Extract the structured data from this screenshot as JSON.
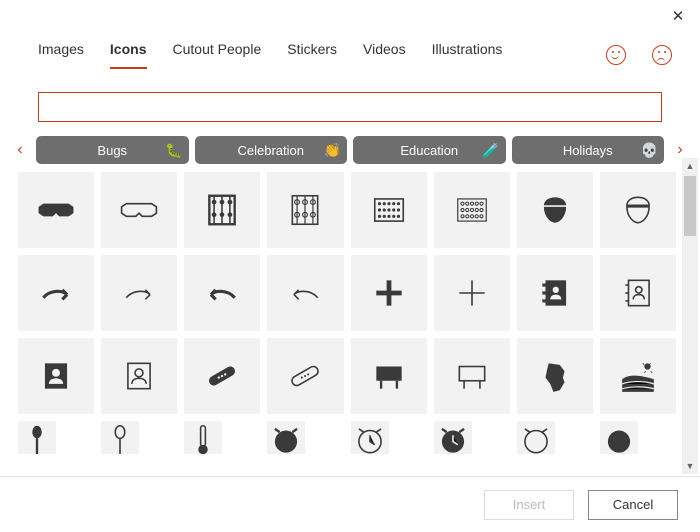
{
  "titlebar": {
    "close": "✕"
  },
  "tabs": {
    "images": "Images",
    "icons": "Icons",
    "cutout": "Cutout People",
    "stickers": "Stickers",
    "videos": "Videos",
    "illustrations": "Illustrations"
  },
  "search": {
    "value": "",
    "placeholder": ""
  },
  "categories": {
    "left_arrow": "‹",
    "right_arrow": "›",
    "items": {
      "bugs": "Bugs",
      "celebration": "Celebration",
      "education": "Education",
      "holidays": "Holidays"
    },
    "decor": {
      "bugs": "🐛",
      "celebration": "👏",
      "education": "🧪",
      "holidays": "💀"
    }
  },
  "icons_grid": {
    "row1": [
      "3d-glasses-filled",
      "3d-glasses-outline",
      "abacus-1",
      "abacus-2",
      "abacus-grid-1",
      "abacus-grid-2",
      "acorn-filled",
      "acorn-outline"
    ],
    "row2": [
      "arrow-curve-right-bold",
      "arrow-curve-right",
      "arrow-curve-left-bold",
      "arrow-curve-left",
      "plus-bold",
      "plus-thin",
      "address-book-filled",
      "address-book-outline"
    ],
    "row3": [
      "address-card-filled",
      "address-card-outline",
      "bandage-filled",
      "bandage-outline",
      "billboard-filled",
      "billboard-outline",
      "africa-filled",
      "agriculture-field"
    ],
    "row4_partial": [
      "pin",
      "pin-outline",
      "thermometer",
      "alarm-clock-1",
      "alarm-clock-2",
      "alarm-clock-3",
      "alarm-clock-4",
      "circle-icon"
    ]
  },
  "footer": {
    "insert": "Insert",
    "cancel": "Cancel"
  },
  "scrollbar": {
    "up": "▲",
    "down": "▼"
  }
}
